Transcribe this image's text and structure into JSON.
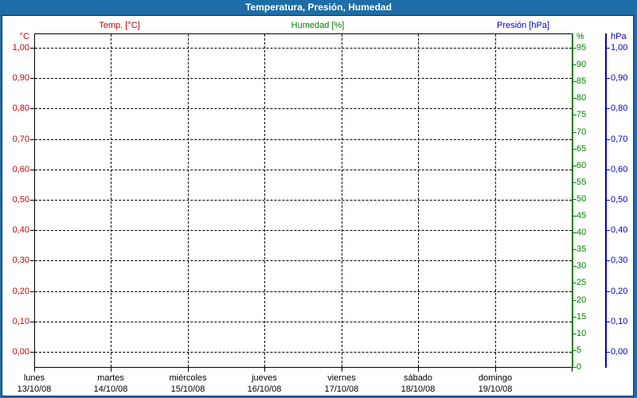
{
  "title_bar": {
    "title": "Temperatura, Presión, Humedad"
  },
  "legend": [
    {
      "label": "Temp. [°C]",
      "color": "#cc0000"
    },
    {
      "label": "Humedad [%]",
      "color": "#008000"
    },
    {
      "label": "Presión [hPa]",
      "color": "#0000cc"
    }
  ],
  "chart_data": {
    "type": "line",
    "title": "Temperatura, Presión, Humedad",
    "grid": true,
    "series": [
      {
        "name": "Temp. [°C]",
        "axis": "temperature_left",
        "color": "#cc0000",
        "values": []
      },
      {
        "name": "Humedad [%]",
        "axis": "humidity_right",
        "color": "#008000",
        "values": []
      },
      {
        "name": "Presión [hPa]",
        "axis": "pressure_right",
        "color": "#0000cc",
        "values": []
      }
    ],
    "axes": {
      "temperature_left": {
        "unit": "°C",
        "color": "#cc0000",
        "range": [
          0.0,
          1.0
        ],
        "ticks": [
          "1,00",
          "0,90",
          "0,80",
          "0,70",
          "0,60",
          "0,50",
          "0,40",
          "0,30",
          "0,20",
          "0,10",
          "0,00"
        ]
      },
      "humidity_right": {
        "unit": "%",
        "color": "#008000",
        "range": [
          0,
          95
        ],
        "ticks": [
          "95",
          "90",
          "85",
          "80",
          "75",
          "70",
          "65",
          "60",
          "55",
          "50",
          "45",
          "40",
          "35",
          "30",
          "25",
          "20",
          "15",
          "10",
          "5",
          "0"
        ]
      },
      "pressure_right": {
        "unit": "hPa",
        "color": "#0000cc",
        "range": [
          0.0,
          1.0
        ],
        "ticks": [
          "1,00",
          "0,90",
          "0,80",
          "0,70",
          "0,60",
          "0,50",
          "0,40",
          "0,30",
          "0,20",
          "0,10",
          "0,00"
        ]
      },
      "x": {
        "weekdays": [
          "lunes",
          "martes",
          "miércoles",
          "jueves",
          "viernes",
          "sábado",
          "domingo"
        ],
        "dates": [
          "13/10/08",
          "14/10/08",
          "15/10/08",
          "16/10/08",
          "17/10/08",
          "18/10/08",
          "19/10/08"
        ]
      }
    }
  }
}
